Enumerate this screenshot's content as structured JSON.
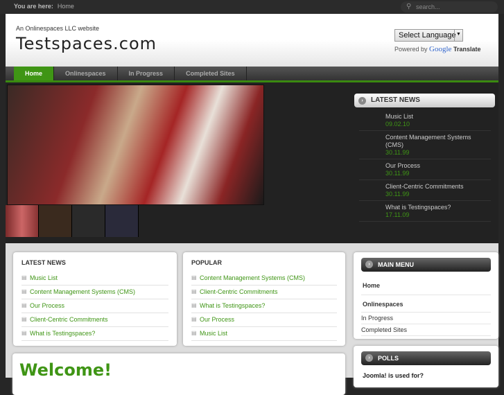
{
  "topbar": {
    "you_are_here": "You are here:",
    "crumb": "Home",
    "search_placeholder": "search..."
  },
  "header": {
    "tagline": "An Onlinespaces LLC website",
    "logo": "Testspaces.com",
    "language": "Select Language",
    "powered_by": "Powered by",
    "google": "Google",
    "translate": "Translate"
  },
  "nav": [
    "Home",
    "Onlinespaces",
    "In Progress",
    "Completed Sites"
  ],
  "latest_news_dark": {
    "title": "LATEST NEWS",
    "items": [
      {
        "title": "Music List",
        "date": "09.02.10"
      },
      {
        "title": "Content Management Systems (CMS)",
        "date": "30.11.99"
      },
      {
        "title": "Our Process",
        "date": "30.11.99"
      },
      {
        "title": "Client-Centric Commitments",
        "date": "30.11.99"
      },
      {
        "title": "What is Testingspaces?",
        "date": "17.11.09"
      }
    ]
  },
  "latest_news": {
    "title": "LATEST NEWS",
    "items": [
      "Music List",
      "Content Management Systems (CMS)",
      "Our Process",
      "Client-Centric Commitments",
      "What is Testingspaces?"
    ]
  },
  "popular": {
    "title": "POPULAR",
    "items": [
      "Content Management Systems (CMS)",
      "Client-Centric Commitments",
      "What is Testingspaces?",
      "Our Process",
      "Music List"
    ]
  },
  "main_menu": {
    "title": "MAIN MENU",
    "items": [
      "Home",
      "Onlinespaces",
      "In Progress",
      "Completed Sites"
    ]
  },
  "polls": {
    "title": "POLLS",
    "question": "Joomla! is used for?"
  },
  "welcome": "Welcome!"
}
